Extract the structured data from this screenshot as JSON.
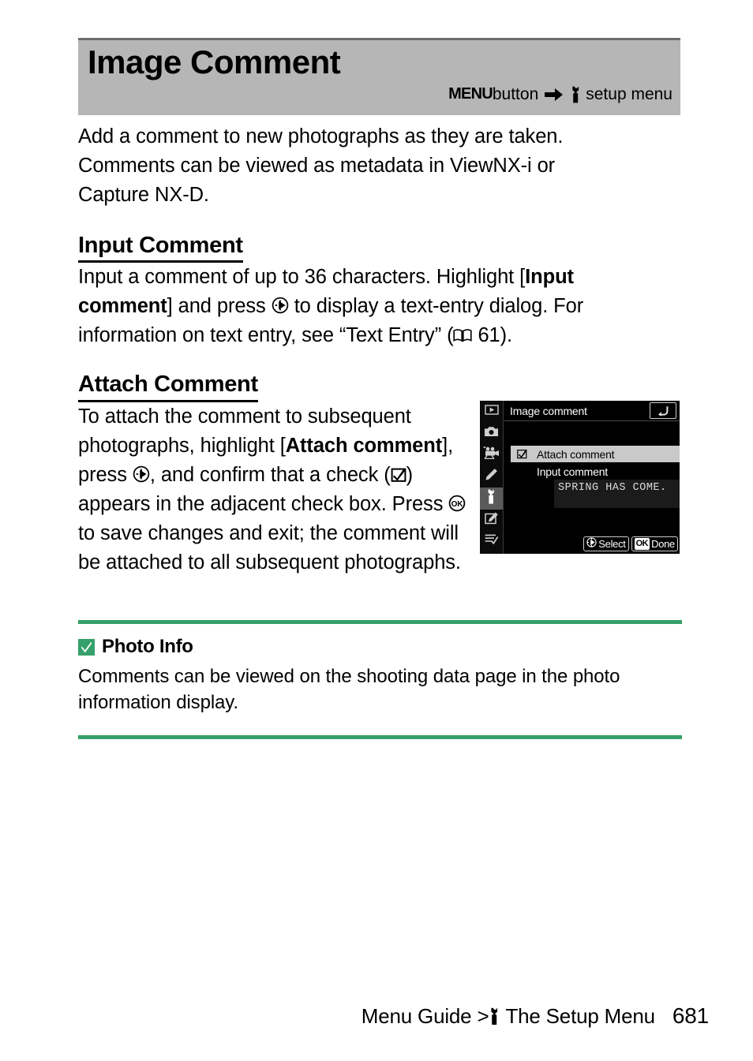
{
  "header": {
    "title": "Image Comment",
    "path_menu_word": "MENU",
    "path_button_word": " button",
    "path_arrow_icon": "arrow-right-icon",
    "path_wrench_icon": "wrench-icon",
    "path_destination": "setup menu"
  },
  "intro": {
    "text": "Add a comment to new photographs as they are taken. Comments can be viewed as metadata in ViewNX-i or Capture NX-D."
  },
  "sections": [
    {
      "heading": "Input Comment",
      "text_part_1": "Input a comment of up to 36 characters. Highlight [",
      "bold_1": "Input comment",
      "text_part_2": "] and press ",
      "icon_1": "multi-selector-right-icon",
      "text_part_3": " to display a text-entry dialog. For information on text entry, see “Text Entry” (",
      "icon_2": "book-reference-icon",
      "text_part_4": " 61)."
    },
    {
      "heading": "Attach Comment",
      "text_part_1": "To attach the comment to subsequent photographs, highlight [",
      "bold_1": "Attach comment",
      "text_part_2": "], press ",
      "icon_1": "multi-selector-right-icon",
      "text_part_3": ", and confirm that a check (",
      "icon_2": "checkbox-checked-icon",
      "text_part_4": ") appears in the adjacent check box. Press ",
      "icon_3": "ok-button-icon",
      "text_part_5": " to save changes and exit; the comment will be attached to all subsequent photographs."
    }
  ],
  "lcd": {
    "title": "Image comment",
    "return_icon": "return-arrow-icon",
    "sidebar_items": [
      {
        "name": "playback-menu-icon"
      },
      {
        "name": "photo-shooting-menu-icon"
      },
      {
        "name": "movie-shooting-menu-icon"
      },
      {
        "name": "custom-settings-menu-icon"
      },
      {
        "name": "setup-menu-icon",
        "active": true
      },
      {
        "name": "retouch-menu-icon"
      },
      {
        "name": "my-menu-icon"
      }
    ],
    "rows": [
      {
        "label": "Attach comment",
        "checked": true,
        "highlighted": true
      },
      {
        "label": "Input comment",
        "checked": false,
        "highlighted": false
      }
    ],
    "comment_value": "SPRING HAS COME.",
    "footer_buttons": [
      {
        "icon": "multi-selector-icon",
        "label": "Select"
      },
      {
        "icon": "ok-button-icon",
        "badge": "OK",
        "label": "Done"
      }
    ]
  },
  "note": {
    "icon": "green-check-icon",
    "title": "Photo Info",
    "body": "Comments can be viewed on the shooting data page in the photo information display.",
    "accent_color": "#35a06a"
  },
  "footer": {
    "breadcrumb_before": "Menu Guide > ",
    "breadcrumb_icon": "wrench-icon",
    "breadcrumb_after": "The Setup Menu",
    "page_number": "681"
  },
  "colors": {
    "header_band": "#b6b6b6",
    "header_top_rule": "#6d6d6d",
    "note_green": "#35a06a",
    "lcd_highlight": "#c9c9c9"
  }
}
